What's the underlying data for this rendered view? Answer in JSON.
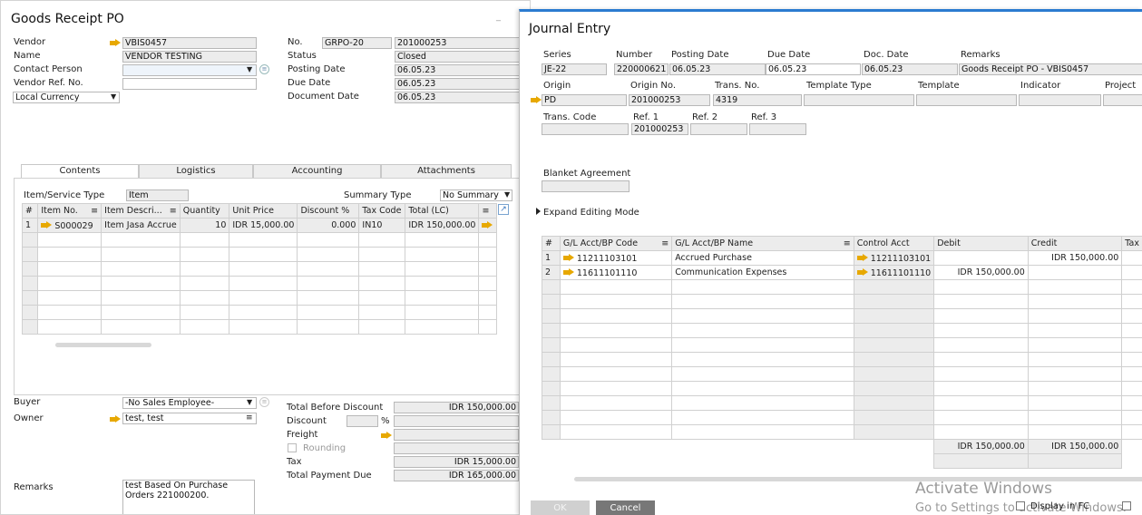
{
  "grpo": {
    "title": "Goods Receipt PO",
    "vendor_label": "Vendor",
    "vendor_value": "VBIS0457",
    "name_label": "Name",
    "name_value": "VENDOR TESTING",
    "contact_label": "Contact Person",
    "contact_value": "",
    "vref_label": "Vendor Ref. No.",
    "vref_value": "",
    "currency_value": "Local Currency",
    "no_label": "No.",
    "no_series": "GRPO-20",
    "no_value": "201000253",
    "status_label": "Status",
    "status_value": "Closed",
    "posting_label": "Posting Date",
    "posting_value": "06.05.23",
    "due_label": "Due Date",
    "due_value": "06.05.23",
    "docdate_label": "Document Date",
    "docdate_value": "06.05.23",
    "tabs": [
      "Contents",
      "Logistics",
      "Accounting",
      "Attachments"
    ],
    "item_type_label": "Item/Service Type",
    "item_type_value": "Item",
    "summary_label": "Summary Type",
    "summary_value": "No Summary",
    "columns": [
      "#",
      "Item No.",
      "Item Descri...",
      "Quantity",
      "Unit Price",
      "Discount %",
      "Tax Code",
      "Total (LC)"
    ],
    "row": {
      "idx": "1",
      "item_no": "S000029",
      "desc": "Item Jasa Accrue",
      "qty": "10",
      "price": "IDR 15,000.00",
      "disc": "0.000",
      "tax": "IN10",
      "total": "IDR 150,000.00"
    },
    "buyer_label": "Buyer",
    "buyer_value": "-No Sales Employee-",
    "owner_label": "Owner",
    "owner_value": "test, test",
    "remarks_label": "Remarks",
    "remarks_value": "test Based On Purchase Orders 221000200.",
    "tbd_label": "Total Before Discount",
    "tbd_value": "IDR 150,000.00",
    "discount_label": "Discount",
    "percent": "%",
    "freight_label": "Freight",
    "rounding_label": "Rounding",
    "tax_label": "Tax",
    "tax_value": "IDR 15,000.00",
    "tpd_label": "Total Payment Due",
    "tpd_value": "IDR 165,000.00"
  },
  "je": {
    "title": "Journal Entry",
    "h1": {
      "series_label": "Series",
      "series": "JE-22",
      "number_label": "Number",
      "number": "220000621",
      "posting_label": "Posting Date",
      "posting": "06.05.23",
      "due_label": "Due Date",
      "due": "06.05.23",
      "doc_label": "Doc. Date",
      "doc": "06.05.23",
      "remarks_label": "Remarks",
      "remarks": "Goods Receipt PO - VBIS0457"
    },
    "h2": {
      "origin_label": "Origin",
      "origin": "PD",
      "origin_no_label": "Origin No.",
      "origin_no": "201000253",
      "trans_label": "Trans. No.",
      "trans": "4319",
      "ttype_label": "Template Type",
      "template_label": "Template",
      "indicator_label": "Indicator",
      "project_label": "Project"
    },
    "h3": {
      "tcode_label": "Trans. Code",
      "ref1_label": "Ref. 1",
      "ref1": "201000253",
      "ref2_label": "Ref. 2",
      "ref3_label": "Ref. 3"
    },
    "blanket_label": "Blanket Agreement",
    "expand_label": "Expand Editing Mode",
    "columns": [
      "#",
      "G/L Acct/BP Code",
      "G/L Acct/BP Name",
      "Control Acct",
      "Debit",
      "Credit",
      "Tax"
    ],
    "rows": [
      {
        "idx": "1",
        "code": "11211103101",
        "name": "Accrued Purchase",
        "ctrl": "11211103101",
        "debit": "",
        "credit": "IDR 150,000.00"
      },
      {
        "idx": "2",
        "code": "11611101110",
        "name": "Communication Expenses",
        "ctrl": "11611101110",
        "debit": "IDR 150,000.00",
        "credit": ""
      }
    ],
    "total_debit": "IDR 150,000.00",
    "total_credit": "IDR 150,000.00",
    "ok_label": "OK",
    "cancel_label": "Cancel",
    "display_fc_label": "Display in FC",
    "watermark1": "Activate Windows",
    "watermark2": "Go to Settings to activate Windows."
  }
}
